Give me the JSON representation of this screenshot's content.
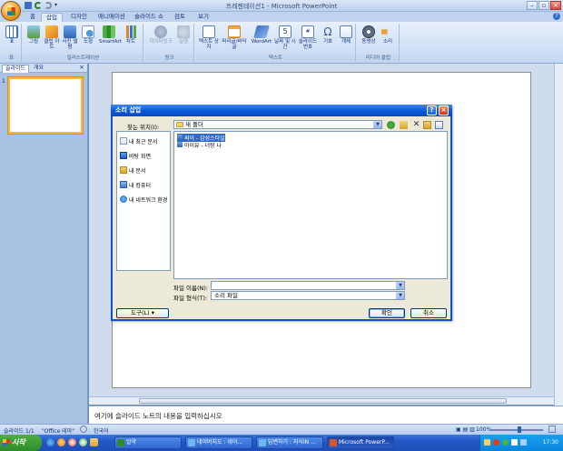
{
  "window": {
    "title": "프레젠테이션1 - Microsoft PowerPoint",
    "controls": [
      "–",
      "▫",
      "×"
    ]
  },
  "ribbon": {
    "tabs": [
      "홈",
      "삽입",
      "디자인",
      "애니메이션",
      "슬라이드 쇼",
      "검토",
      "보기"
    ],
    "active_tab": "삽입",
    "groups": [
      {
        "label": "표",
        "buttons": [
          "표"
        ]
      },
      {
        "label": "일러스트레이션",
        "buttons": [
          "그림",
          "클립 아트",
          "사진 앨범",
          "도형",
          "SmartArt",
          "차트"
        ]
      },
      {
        "label": "링크",
        "buttons": [
          "하이퍼링크",
          "실행"
        ]
      },
      {
        "label": "텍스트",
        "buttons": [
          "텍스트 상자",
          "머리글/바닥글",
          "WordArt",
          "날짜 및 시간",
          "슬라이드 번호",
          "기호",
          "개체"
        ]
      },
      {
        "label": "미디어 클립",
        "buttons": [
          "동영상",
          "소리"
        ]
      }
    ]
  },
  "left_pane": {
    "tabs": [
      "슬라이드",
      "개요"
    ],
    "close": "×",
    "slide_number": "1"
  },
  "notes": {
    "placeholder": "여기에 슬라이드 노트의 내용을 입력하십시오"
  },
  "dialog": {
    "title": "소리 삽입",
    "help": "?",
    "close": "×",
    "look_in_label": "찾는 위치(I):",
    "look_in_value": "새 폴더",
    "places": [
      "내 최근 문서",
      "바탕 화면",
      "내 문서",
      "내 컴퓨터",
      "내 네트워크 환경"
    ],
    "files": [
      {
        "name": "써이 - 감성스타일",
        "selected": true
      },
      {
        "name": "아이유 - 너랑 나",
        "selected": false
      }
    ],
    "filename_label": "파일 이름(N):",
    "filename_value": "",
    "filetype_label": "파일 형식(T):",
    "filetype_value": "소리 파일",
    "tools_label": "도구(L)",
    "ok_label": "확인",
    "cancel_label": "취소"
  },
  "status": {
    "slide": "슬라이드 1/1",
    "theme": "\"Office 테마\"",
    "language": "한국어",
    "zoom": "100%"
  },
  "taskbar": {
    "start": "시작",
    "tasks": [
      {
        "label": "알약",
        "active": false
      },
      {
        "label": "네이버지도 : 네이...",
        "active": false
      },
      {
        "label": "답변하기 : 지식iN ...",
        "active": false
      },
      {
        "label": "Microsoft PowerP...",
        "active": true
      }
    ],
    "clock": "17:30"
  },
  "colors": {
    "accent": "#0a5ad9",
    "ribbon_bg": "#dbe8f8",
    "taskbar": "#2457c6",
    "start": "#3b8f2b",
    "selection": "#316ac5"
  }
}
